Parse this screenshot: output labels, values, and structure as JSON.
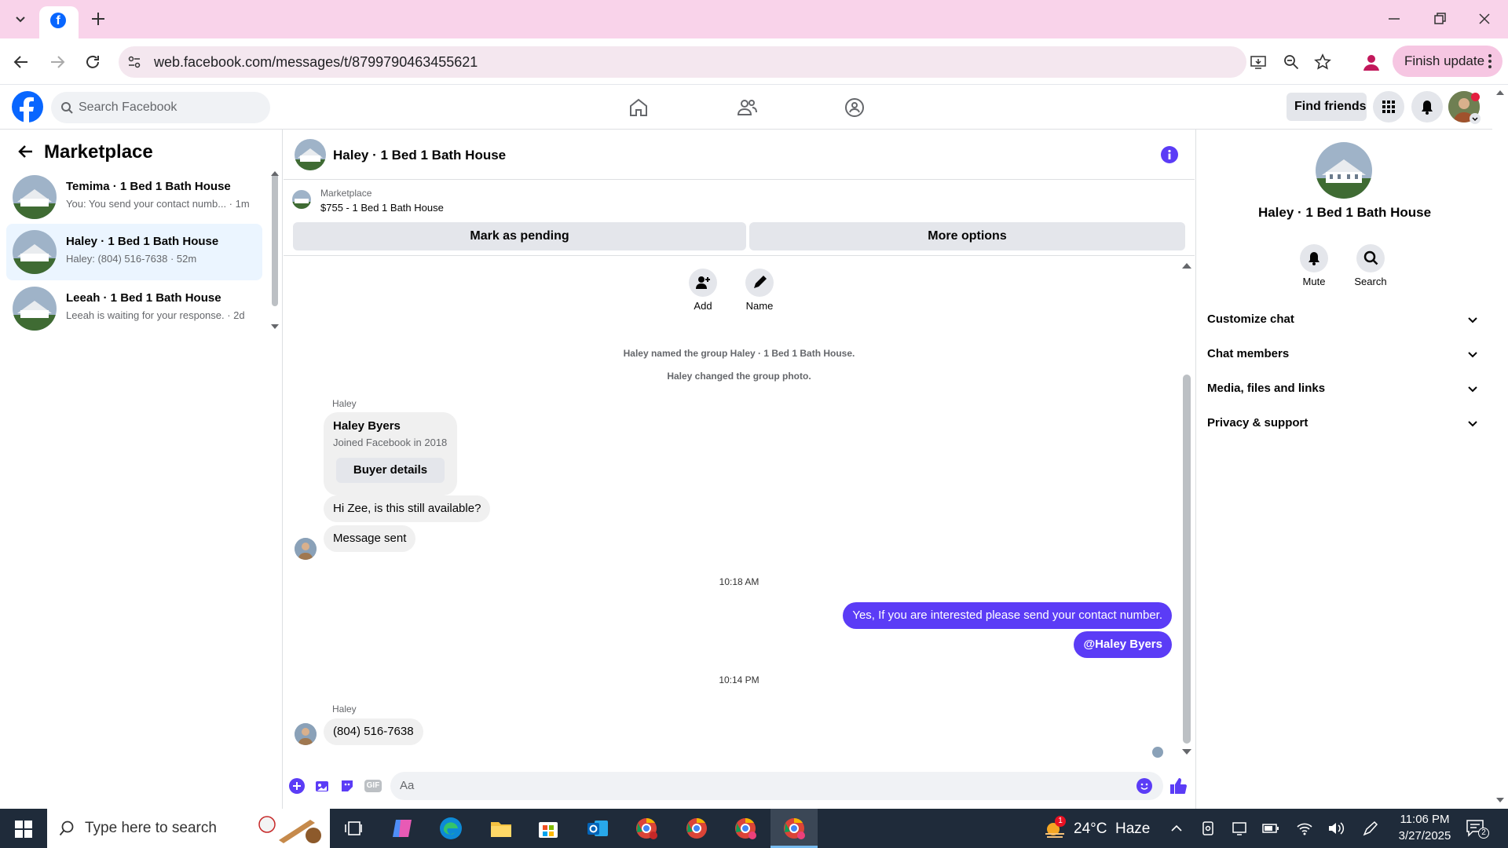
{
  "browser": {
    "url": "web.facebook.com/messages/t/8799790463455621",
    "finish_update": "Finish update"
  },
  "fb": {
    "search_placeholder": "Search Facebook",
    "find_friends": "Find friends"
  },
  "sidebar": {
    "title": "Marketplace",
    "conversations": [
      {
        "name": "Temima · 1 Bed 1 Bath House",
        "preview": "You: You send your contact numb... · 1m",
        "active": false
      },
      {
        "name": "Haley · 1 Bed 1 Bath House",
        "preview": "Haley: (804) 516-7638 · 52m",
        "active": true
      },
      {
        "name": "Leeah · 1 Bed 1 Bath House",
        "preview": "Leeah is waiting for your response. · 2d",
        "active": false
      }
    ]
  },
  "chat": {
    "title": "Haley · 1 Bed 1 Bath House",
    "marketplace_label": "Marketplace",
    "listing": "$755 - 1 Bed 1 Bath House",
    "mark_pending": "Mark as pending",
    "more_options": "More options",
    "add_label": "Add",
    "name_label": "Name",
    "system_1": "Haley named the group Haley · 1 Bed 1 Bath House.",
    "system_2": "Haley changed the group photo.",
    "sender_1": "Haley",
    "buyer_name": "Haley Byers",
    "buyer_joined": "Joined Facebook in 2018",
    "buyer_details": "Buyer details",
    "msg_in_1": "Hi Zee, is this still available?",
    "msg_in_2": "Message sent",
    "time_1": "10:18 AM",
    "msg_out_1": "Yes,  If you are interested please send your contact number.",
    "msg_out_2": "@Haley Byers",
    "time_2": "10:14 PM",
    "sender_2": "Haley",
    "msg_in_3": "(804) 516-7638",
    "composer_placeholder": "Aa"
  },
  "right_panel": {
    "title": "Haley · 1 Bed 1 Bath House",
    "mute": "Mute",
    "search": "Search",
    "sections": [
      "Customize chat",
      "Chat members",
      "Media, files and links",
      "Privacy & support"
    ]
  },
  "taskbar": {
    "search_placeholder": "Type here to search",
    "weather": "24°C  Haze",
    "time": "11:06 PM",
    "date": "3/27/2025",
    "notif_count": "2",
    "weather_badge": "1"
  },
  "colors": {
    "fb_blue": "#0866ff",
    "messenger_purple": "#5b3cf6",
    "chrome_pink": "#f9d3ea"
  }
}
